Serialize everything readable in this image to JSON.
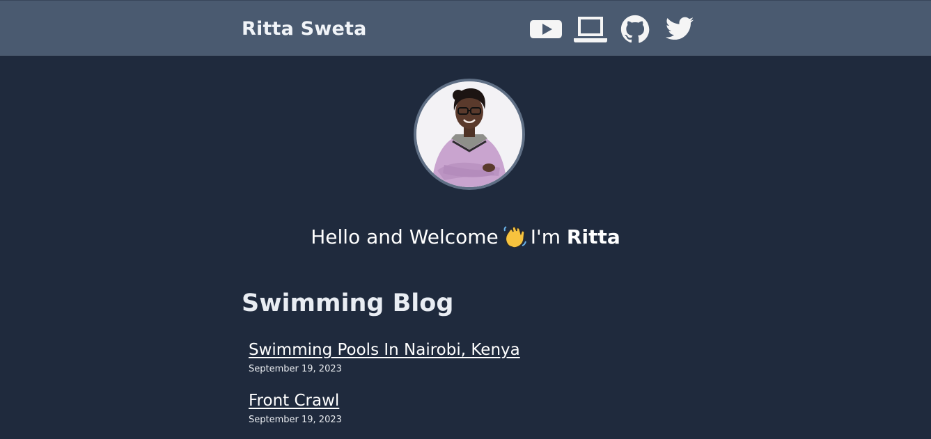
{
  "header": {
    "site_title": "Ritta Sweta",
    "social_icons": [
      "youtube-icon",
      "laptop-icon",
      "github-icon",
      "twitter-icon"
    ]
  },
  "hero": {
    "greeting_prefix": "Hello and Welcome",
    "greeting_emoji": "waving-hand-icon",
    "greeting_middle": "I'm",
    "greeting_name": "Ritta"
  },
  "blog": {
    "section_title": "Swimming Blog",
    "posts": [
      {
        "title": "Swimming Pools In Nairobi, Kenya",
        "date": "September 19, 2023"
      },
      {
        "title": "Front Crawl",
        "date": "September 19, 2023"
      }
    ]
  },
  "colors": {
    "page_background": "#1f2a3d",
    "header_background": "#4a5a70",
    "avatar_border": "#5f6f85",
    "text": "#ffffff"
  }
}
